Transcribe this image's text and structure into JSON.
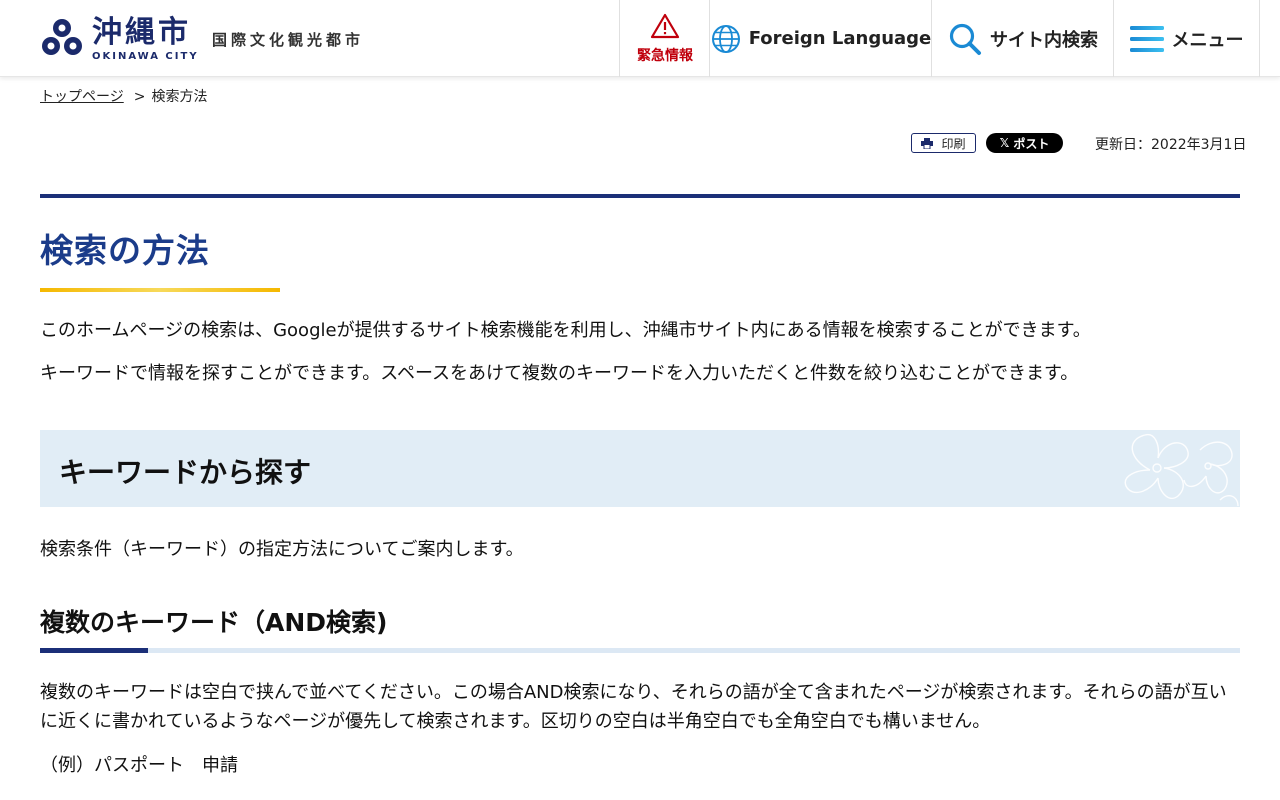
{
  "header": {
    "logo_name": "沖縄市",
    "logo_en": "OKINAWA CITY",
    "tagline": "国際文化観光都市",
    "emergency_label": "緊急情報",
    "language_label": "Foreign Language",
    "search_label": "サイト内検索",
    "menu_label": "メニュー"
  },
  "breadcrumb": {
    "home": "トップページ",
    "separator": ">",
    "current": "検索方法"
  },
  "tools": {
    "print_label": "印刷",
    "post_label": "ポスト",
    "updated": "更新日：2022年3月1日"
  },
  "main": {
    "title": "検索の方法",
    "intro1": "このホームページの検索は、Googleが提供するサイト検索機能を利用し、沖縄市サイト内にある情報を検索することができます。",
    "intro2": "キーワードで情報を探すことができます。スペースをあけて複数のキーワードを入力いただくと件数を絞り込むことができます。",
    "section_heading": "キーワードから探す",
    "section_intro": "検索条件（キーワード）の指定方法についてご案内します。",
    "subheading": "複数のキーワード（AND検索)",
    "and_desc": "複数のキーワードは空白で挟んで並べてください。この場合AND検索になり、それらの語が全て含まれたページが検索されます。それらの語が互いに近くに書かれているようなページが優先して検索されます。区切りの空白は半角空白でも全角空白でも構いません。",
    "example": "（例）パスポート　申請"
  },
  "colors": {
    "brand_navy": "#1b2f78",
    "title_blue": "#1b3c8a",
    "emergency_red": "#c0000c",
    "accent_yellow": "#f5b800",
    "section_bg": "#e1edf6"
  }
}
